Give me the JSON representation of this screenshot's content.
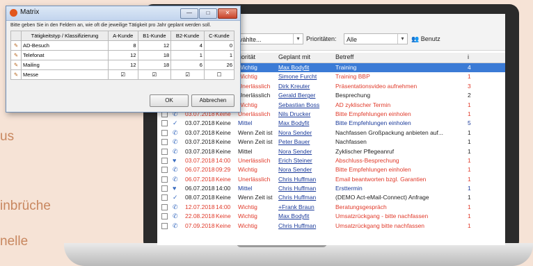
{
  "background": {
    "partial_texts": [
      "us",
      "inbrüche",
      "nelle"
    ]
  },
  "app": {
    "toolbar": {
      "combo_text": "vählte...",
      "priority_label": "Prioritäten:",
      "priority_value": "Alle",
      "user_label": "Benutz"
    },
    "table": {
      "headers": [
        "riorität",
        "Geplant mit",
        "Betreff",
        "i"
      ],
      "rows": [
        {
          "date": "",
          "time": "",
          "prio": "Wichtig",
          "prio2": "Wichtig",
          "person": "Max Bodyfit",
          "subject": "Training",
          "selected": true,
          "icon": "phone-icon",
          "color": "red"
        },
        {
          "date": "",
          "time": "",
          "prio": "Keine",
          "prio2": "Wichtig",
          "person": "Simone Furcht",
          "subject": "Training BBP",
          "selected": false,
          "icon": "phone-icon",
          "color": "red"
        },
        {
          "date": "",
          "time": "",
          "prio": "Keine",
          "prio2": "Unerlässlich",
          "person": "Dirk Kreuter",
          "subject": "Präsentationsvideo aufnehmen",
          "selected": false,
          "icon": "phone-icon",
          "color": "red"
        },
        {
          "date": "",
          "time": "",
          "prio": "Keine",
          "prio2": "Unerlässlich",
          "person": "Gerald Berger",
          "subject": "Besprechung",
          "selected": false,
          "icon": "phone-icon",
          "color": "black"
        },
        {
          "date": "",
          "time": "",
          "prio": "Keine",
          "prio2": "Wichtig",
          "person": "Sebastian Boss",
          "subject": "AD zyklischer Termin",
          "selected": false,
          "icon": "phone-icon",
          "color": "red"
        },
        {
          "date": "03.07.2018",
          "time": "Keine",
          "prio": "Keine",
          "prio2": "Unerlässlich",
          "person": "Nils Drucker",
          "subject": "Bitte Empfehlungen einholen",
          "selected": false,
          "icon": "phone-icon",
          "color": "red"
        },
        {
          "date": "03.07.2018",
          "time": "Keine",
          "prio": "Keine",
          "prio2": "Mittel",
          "person": "Max Bodyfit",
          "subject": "Bitte Empfehlungen einholen",
          "selected": false,
          "icon": "check-icon",
          "color": "blue"
        },
        {
          "date": "03.07.2018",
          "time": "Keine",
          "prio": "Keine",
          "prio2": "Wenn Zeit ist",
          "person": "Nora Sender",
          "subject": "Nachfassen Großpackung anbieten auf...",
          "selected": false,
          "icon": "phone-icon",
          "color": "black"
        },
        {
          "date": "03.07.2018",
          "time": "Keine",
          "prio": "Keine",
          "prio2": "Wenn Zeit ist",
          "person": "Peter Bauer",
          "subject": "Nachfassen",
          "selected": false,
          "icon": "phone-icon",
          "color": "black"
        },
        {
          "date": "03.07.2018",
          "time": "Keine",
          "prio": "Keine",
          "prio2": "Mittel",
          "person": "Nora Sender",
          "subject": "Zyklischer Pflegeanruf",
          "selected": false,
          "icon": "phone-icon",
          "color": "black"
        },
        {
          "date": "03.07.2018",
          "time": "14:00",
          "prio": "Keine",
          "prio2": "Unerlässlich",
          "person": "Erich Steiner",
          "subject": "Abschluss-Besprechung",
          "selected": false,
          "icon": "heart-icon",
          "color": "red"
        },
        {
          "date": "06.07.2018",
          "time": "09:29",
          "prio": "Keine",
          "prio2": "Wichtig",
          "person": "Nora Sender",
          "subject": "Bitte Empfehlungen einholen",
          "selected": false,
          "icon": "phone-icon",
          "color": "red"
        },
        {
          "date": "06.07.2018",
          "time": "Keine",
          "prio": "Keine",
          "prio2": "Unerlässlich",
          "person": "Chris Huffman",
          "subject": "Email beantworten bzgl. Garantien",
          "selected": false,
          "icon": "phone-icon",
          "color": "red"
        },
        {
          "date": "06.07.2018",
          "time": "14:00",
          "prio": "Keine",
          "prio2": "Mittel",
          "person": "Chris Huffman",
          "subject": "Ersttermin",
          "selected": false,
          "icon": "heart-icon",
          "color": "blue"
        },
        {
          "date": "08.07.2018",
          "time": "Keine",
          "prio": "Keine",
          "prio2": "Wenn Zeit ist",
          "person": "Chris Huffman",
          "subject": "(DEMO Act-eMail-Connect) Anfrage",
          "selected": false,
          "icon": "check-icon",
          "color": "black"
        },
        {
          "date": "12.07.2018",
          "time": "14:00",
          "prio": "Keine",
          "prio2": "Wichtig",
          "person": "+Frank Braun",
          "subject": "Beratungsgespräch",
          "selected": false,
          "icon": "phone-icon",
          "color": "red"
        },
        {
          "date": "22.08.2018",
          "time": "Keine",
          "prio": "Keine",
          "prio2": "Wichtig",
          "person": "Max Bodyfit",
          "subject": "Umsatzrückgang - bitte nachfassen",
          "selected": false,
          "icon": "phone-icon",
          "color": "red"
        },
        {
          "date": "07.09.2018",
          "time": "Keine",
          "prio": "Keine",
          "prio2": "Wichtig",
          "person": "Chris Huffman",
          "subject": "Umsatzrückgang bitte nachfassen",
          "selected": false,
          "icon": "phone-icon",
          "color": "red"
        }
      ],
      "last_col": [
        "4",
        "1",
        "3",
        "2",
        "1",
        "1",
        "5",
        "1",
        "1",
        "1",
        "1",
        "1",
        "1",
        "1",
        "1",
        "1",
        "1",
        "1"
      ]
    }
  },
  "dialog": {
    "title": "Matrix",
    "instruction": "Bitte geben Sie in den Feldern an, wie oft die jeweilige Tätigkeit pro Jahr geplant werden soll.",
    "column_headers": [
      "Tätigkeitstyp / Klassifizierung",
      "A-Kunde",
      "B1-Kunde",
      "B2-Kunde",
      "C-Kunde"
    ],
    "rows": [
      {
        "label": "AD-Besuch",
        "values": [
          "8",
          "12",
          "4",
          "0"
        ]
      },
      {
        "label": "Telefonat",
        "values": [
          "12",
          "18",
          "1",
          "1"
        ]
      },
      {
        "label": "Mailing",
        "values": [
          "12",
          "18",
          "6",
          "26"
        ]
      },
      {
        "label": "Messe",
        "values": [
          "☑",
          "☑",
          "☑",
          "☐"
        ]
      }
    ],
    "ok_label": "OK",
    "cancel_label": "Abbrechen",
    "minimize_label": "—",
    "maximize_label": "□",
    "close_label": "✕"
  },
  "colors": {
    "selected_row": "#3b7bd6",
    "red_text": "#e03a2a",
    "blue_text": "#1a3a9a",
    "background": "#f6e3d6",
    "orange_text": "#c8875f"
  }
}
